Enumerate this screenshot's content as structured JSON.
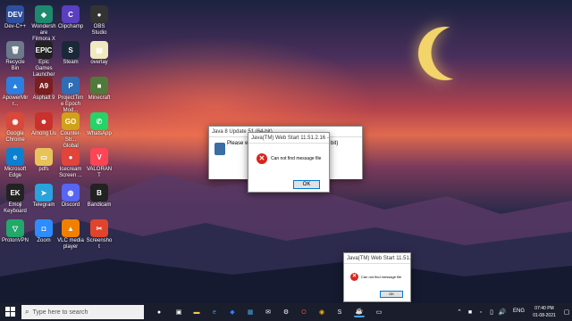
{
  "desktop": {
    "icons": [
      {
        "label": "Dev-C++",
        "glyph": "DEV",
        "color": "#2d4fa0"
      },
      {
        "label": "Wondershare Filmora X",
        "glyph": "◆",
        "color": "#1d8a6e"
      },
      {
        "label": "Clipchamp",
        "glyph": "C",
        "color": "#5a3fc0"
      },
      {
        "label": "OBS Studio",
        "glyph": "●",
        "color": "#333333"
      },
      {
        "label": "Recycle Bin",
        "glyph": "🗑",
        "color": "#6c7a8a"
      },
      {
        "label": "Epic Games Launcher",
        "glyph": "EPIC",
        "color": "#222222"
      },
      {
        "label": "Steam",
        "glyph": "S",
        "color": "#1b2838"
      },
      {
        "label": "overlay",
        "glyph": "▤",
        "color": "#f0e9c0"
      },
      {
        "label": "ApowerMirr...",
        "glyph": "▲",
        "color": "#2a7fe0"
      },
      {
        "label": "Asphalt 9",
        "glyph": "A9",
        "color": "#7a1f1f"
      },
      {
        "label": "ProjectTime Epoch Mod...",
        "glyph": "P",
        "color": "#2f6db5"
      },
      {
        "label": "Minecraft",
        "glyph": "■",
        "color": "#4f7a3a"
      },
      {
        "label": "Google Chrome",
        "glyph": "◉",
        "color": "#d8483b"
      },
      {
        "label": "Among Us",
        "glyph": "☻",
        "color": "#c8312c"
      },
      {
        "label": "Counter-Str... Global Offe...",
        "glyph": "GO",
        "color": "#d0a11a"
      },
      {
        "label": "WhatsApp",
        "glyph": "✆",
        "color": "#25d366"
      },
      {
        "label": "Microsoft Edge",
        "glyph": "e",
        "color": "#0b7fd0"
      },
      {
        "label": "pdfs",
        "glyph": "▭",
        "color": "#e8c35a"
      },
      {
        "label": "Icecream Screen ...",
        "glyph": "●",
        "color": "#e0443a"
      },
      {
        "label": "VALORANT",
        "glyph": "V",
        "color": "#fd4556"
      },
      {
        "label": "Emoji Keyboard",
        "glyph": "EK",
        "color": "#222222"
      },
      {
        "label": "Telegram",
        "glyph": "➤",
        "color": "#2aa3dd"
      },
      {
        "label": "Discord",
        "glyph": "◍",
        "color": "#5865f2"
      },
      {
        "label": "Bandicam",
        "glyph": "B",
        "color": "#222222"
      },
      {
        "label": "ProtonVPN",
        "glyph": "▽",
        "color": "#22a86b"
      },
      {
        "label": "Zoom",
        "glyph": "◘",
        "color": "#2d8cff"
      },
      {
        "label": "VLC media player",
        "glyph": "▲",
        "color": "#f18000"
      },
      {
        "label": "Screenshot",
        "glyph": "✂",
        "color": "#e0442c"
      }
    ]
  },
  "dialogs": {
    "back_title": "Java 8 Update 51 (64-bit)",
    "back_text": "Please wait...",
    "back_right": "bit)",
    "main_title": "Java(TM) Web Start 11.51.2.16 - fcs",
    "main_message": "Can not find message file",
    "main_ok": "OK",
    "mini_title": "Java(TM) Web Start 11.51.2...",
    "mini_message": "Can not find message file",
    "mini_ok": "OK"
  },
  "taskbar": {
    "search_placeholder": "Type here to search",
    "language": "ENG",
    "time": "07:40 PM",
    "date": "01-08-2021"
  }
}
